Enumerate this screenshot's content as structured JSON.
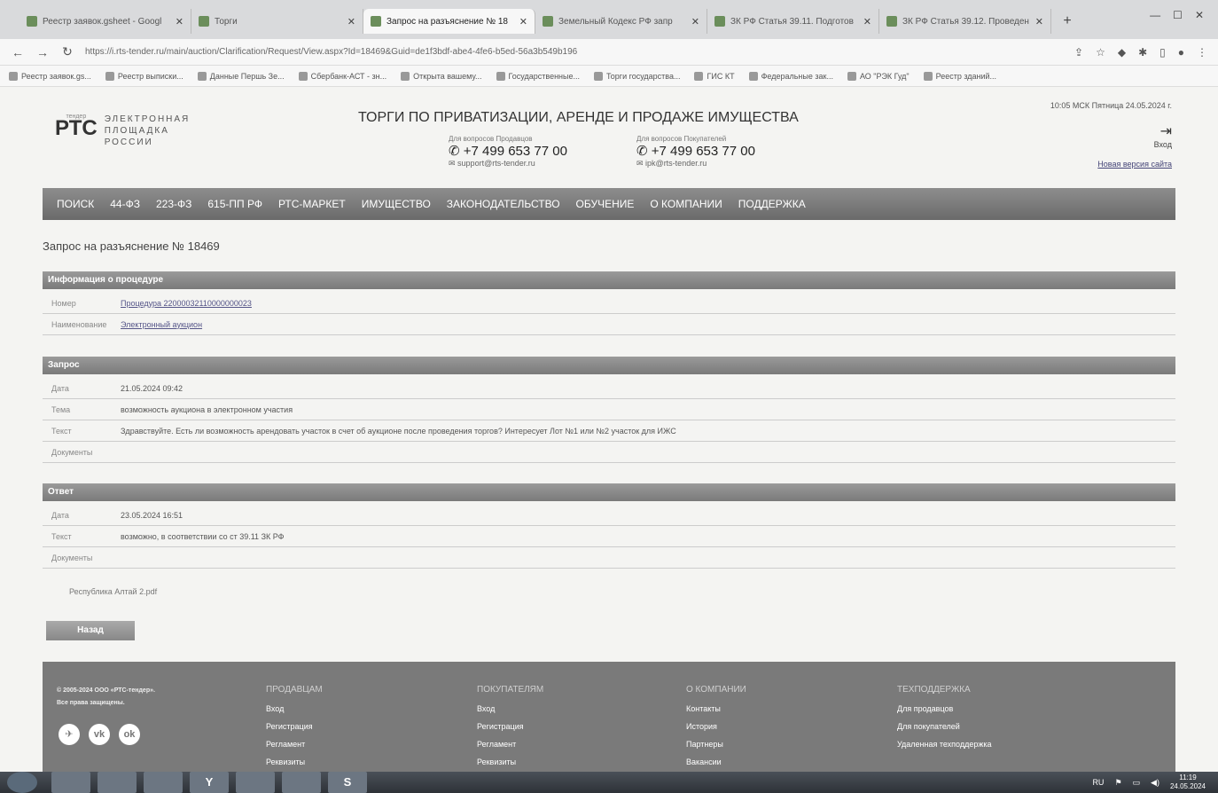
{
  "browser": {
    "tabs": [
      {
        "title": "Реестр заявок.gsheet - Googl",
        "active": false
      },
      {
        "title": "Торги",
        "active": false
      },
      {
        "title": "Запрос на разъяснение № 18",
        "active": true
      },
      {
        "title": "Земельный Кодекс РФ запр",
        "active": false
      },
      {
        "title": "ЗК РФ Статья 39.11. Подготов",
        "active": false
      },
      {
        "title": "ЗК РФ Статья 39.12. Проведен",
        "active": false
      }
    ],
    "url": "https://i.rts-tender.ru/main/auction/Clarification/Request/View.aspx?Id=18469&Guid=de1f3bdf-abe4-4fe6-b5ed-56a3b549b196",
    "bookmarks": [
      "Реестр заявок.gs...",
      "Реестр выписки...",
      "Данные Першь Зе...",
      "Сбербанк-АСТ - зн...",
      "Открыта вашему...",
      "Государственные...",
      "Торги государства...",
      "ГИС КТ",
      "Федеральные зак...",
      "АО \"РЭК Гуд\"",
      "Реестр зданий..."
    ]
  },
  "header": {
    "logo_mark": "РТС",
    "logo_small": "тендер",
    "logo_lines": [
      "ЭЛЕКТРОННАЯ",
      "ПЛОЩАДКА",
      "РОССИИ"
    ],
    "title": "ТОРГИ ПО ПРИВАТИЗАЦИИ, АРЕНДЕ И ПРОДАЖЕ ИМУЩЕСТВА",
    "sellers_label": "Для вопросов Продавцов",
    "sellers_phone": "+7 499 653 77 00",
    "sellers_email": "support@rts-tender.ru",
    "buyers_label": "Для вопросов Покупателей",
    "buyers_phone": "+7 499 653 77 00",
    "buyers_email": "ipk@rts-tender.ru",
    "date": "10:05 МСК Пятница 24.05.2024 г.",
    "login_label": "Вход",
    "new_version": "Новая версия сайта"
  },
  "nav": [
    "ПОИСК",
    "44-ФЗ",
    "223-ФЗ",
    "615-ПП РФ",
    "РТС-МАРКЕТ",
    "ИМУЩЕСТВО",
    "ЗАКОНОДАТЕЛЬСТВО",
    "ОБУЧЕНИЕ",
    "О КОМПАНИИ",
    "ПОДДЕРЖКА"
  ],
  "page_title": "Запрос на разъяснение № 18469",
  "sections": {
    "procedure": {
      "title": "Информация о процедуре",
      "rows": [
        {
          "key": "Номер",
          "value": "Процедура 22000032110000000023"
        },
        {
          "key": "Наименование",
          "value": "Электронный аукцион"
        }
      ]
    },
    "request": {
      "title": "Запрос",
      "rows": [
        {
          "key": "Дата",
          "value": "21.05.2024 09:42"
        },
        {
          "key": "Тема",
          "value": "возможность аукциона в электронном участия"
        },
        {
          "key": "Текст",
          "value": "Здравствуйте. Есть ли возможность арендовать участок в счет об аукционе после проведения торгов? Интересует Лот №1 или №2 участок для ИЖС"
        },
        {
          "key": "Документы",
          "value": ""
        }
      ]
    },
    "answer": {
      "title": "Ответ",
      "rows": [
        {
          "key": "Дата",
          "value": "23.05.2024 16:51"
        },
        {
          "key": "Текст",
          "value": "возможно, в соответствии со ст 39.11 ЗК РФ"
        },
        {
          "key": "Документы",
          "value": ""
        }
      ]
    }
  },
  "attachment": "Республика Алтай 2.pdf",
  "back_button": "Назад",
  "footer": {
    "copyright": [
      "© 2005-2024 ООО «РТС-тендер».",
      "Все права защищены."
    ],
    "social": [
      "✈",
      "vk",
      "ok"
    ],
    "columns": [
      {
        "title": "ПРОДАВЦАМ",
        "links": [
          "Вход",
          "Регистрация",
          "Регламент",
          "Реквизиты"
        ]
      },
      {
        "title": "ПОКУПАТЕЛЯМ",
        "links": [
          "Вход",
          "Регистрация",
          "Регламент",
          "Реквизиты"
        ]
      },
      {
        "title": "О КОМПАНИИ",
        "links": [
          "Контакты",
          "История",
          "Партнеры",
          "Вакансии"
        ]
      },
      {
        "title": "ТЕХПОДДЕРЖКА",
        "links": [
          "Для продавцов",
          "Для покупателей",
          "Удаленная техподдержка"
        ]
      }
    ]
  },
  "taskbar": {
    "apps": [
      "",
      "",
      "",
      "Y",
      "",
      "",
      "S"
    ],
    "lang": "RU",
    "time": "11:19",
    "date": "24.05.2024"
  }
}
